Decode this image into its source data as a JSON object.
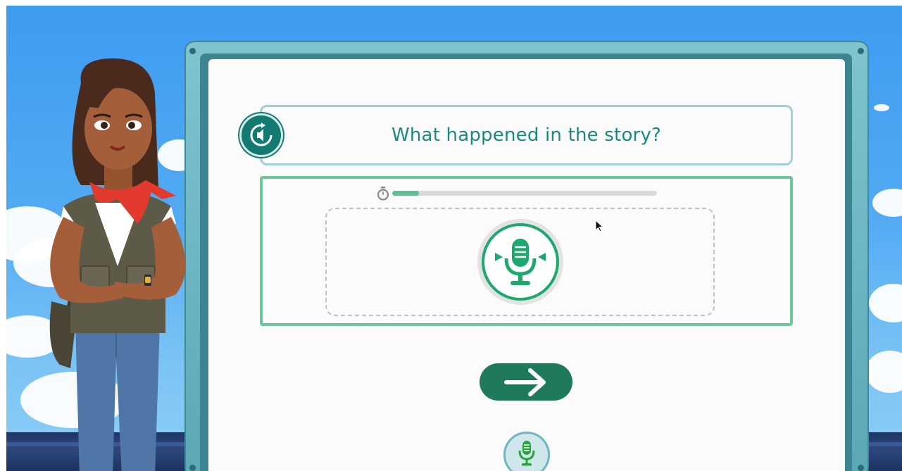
{
  "question": {
    "text": "What happened in the story?"
  },
  "replay_button": {
    "icon": "replay-audio-icon"
  },
  "timer": {
    "icon": "stopwatch-icon",
    "progress": 0.1,
    "fill_color": "#5bc08d",
    "track_color": "#d9d9d9"
  },
  "record": {
    "icon": "microphone-icon",
    "accent": "#1fa86e"
  },
  "next_button": {
    "icon": "arrow-right-icon",
    "color": "#1f7a5a"
  },
  "bottom_tab": {
    "icon": "microphone-icon"
  },
  "colors": {
    "sky": "#52aaf3",
    "board_frame": "#5aa7b6",
    "question_text": "#1a8a7f",
    "panel_border": "#6cc79c"
  }
}
